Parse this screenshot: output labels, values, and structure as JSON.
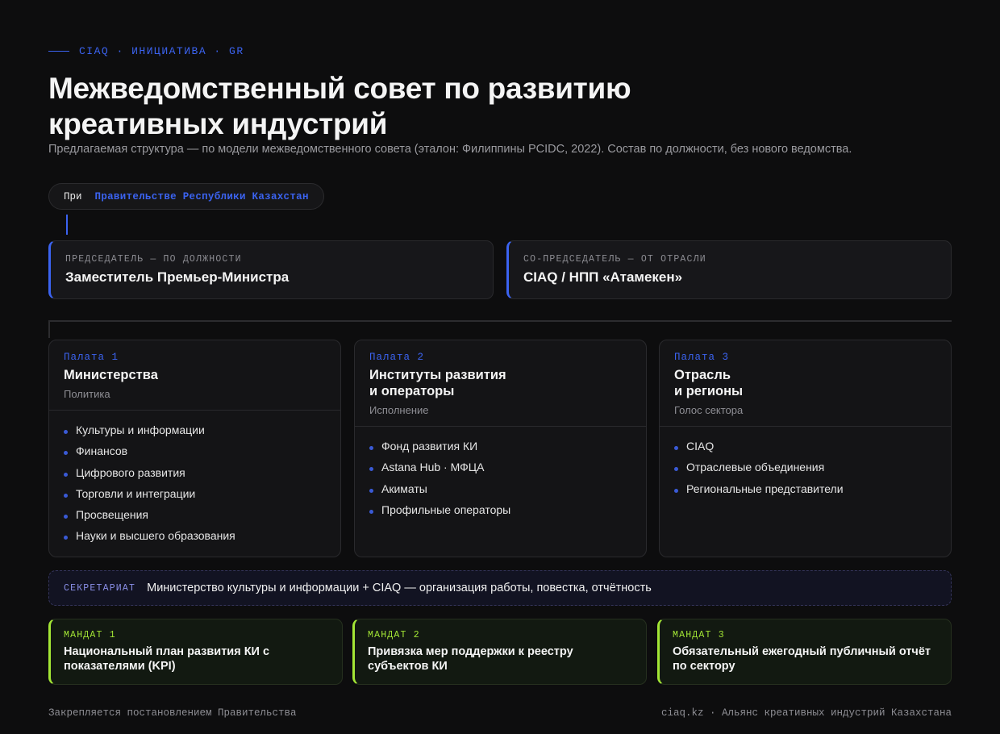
{
  "eyebrow": "CIAQ · ИНИЦИАТИВА · GR",
  "title": {
    "line1": "Межведомственный совет по развитию",
    "line2": "креативных индустрий"
  },
  "subtitle": "Предлагаемая структура — по модели межведомственного совета (эталон: Филиппины PCIDC, 2022). Состав по должности, без нового ведомства.",
  "parent": {
    "prefix": "При",
    "name": "Правительстве Республики Казахстан"
  },
  "chairs": [
    {
      "label": "ПРЕДСЕДАТЕЛЬ — ПО ДОЛЖНОСТИ",
      "value": "Заместитель Премьер-Министра"
    },
    {
      "label": "СО-ПРЕДСЕДАТЕЛЬ — ОТ ОТРАСЛИ",
      "value": "CIAQ / НПП «Атамекен»"
    }
  ],
  "chambers": [
    {
      "num": "Палата 1",
      "name_lines": [
        "Министерства",
        ""
      ],
      "role": "Политика",
      "items": [
        "Культуры и информации",
        "Финансов",
        "Цифрового развития",
        "Торговли и интеграции",
        "Просвещения",
        "Науки и высшего образования"
      ]
    },
    {
      "num": "Палата 2",
      "name_lines": [
        "Институты развития",
        "и операторы"
      ],
      "role": "Исполнение",
      "items": [
        "Фонд развития КИ",
        "Astana Hub · МФЦА",
        "Акиматы",
        "Профильные операторы"
      ]
    },
    {
      "num": "Палата 3",
      "name_lines": [
        "Отрасль",
        "и регионы"
      ],
      "role": "Голос сектора",
      "items": [
        "CIAQ",
        "Отраслевые объединения",
        "Региональные представители"
      ]
    }
  ],
  "secretariat": {
    "label": "СЕКРЕТАРИАТ",
    "value": "Министерство культуры и информации + CIAQ — организация работы, повестка, отчётность"
  },
  "mandates": [
    {
      "label": "МАНДАТ 1",
      "lines": [
        "Национальный план развития КИ с",
        "показателями (KPI)"
      ]
    },
    {
      "label": "МАНДАТ 2",
      "lines": [
        "Привязка мер поддержки к реестру",
        "субъектов КИ"
      ]
    },
    {
      "label": "МАНДАТ 3",
      "lines": [
        "Обязательный ежегодный публичный отчёт",
        "по сектору"
      ]
    }
  ],
  "footer": {
    "left": "Закрепляется постановлением Правительства",
    "right": "ciaq.kz · Альянс креативных индустрий Казахстана"
  }
}
